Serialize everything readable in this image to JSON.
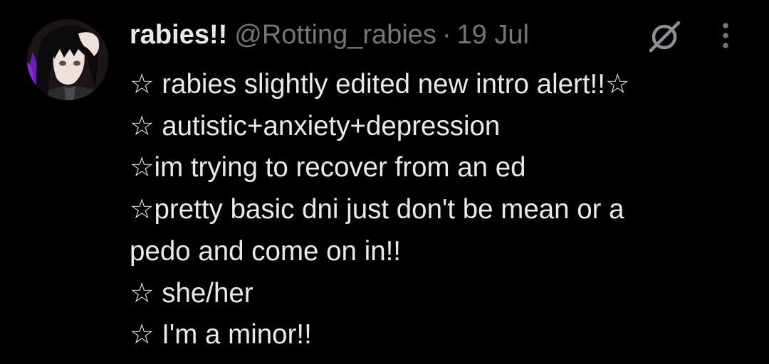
{
  "post": {
    "display_name": "rabies!!",
    "handle": "@Rotting_rabies",
    "separator": "·",
    "date": "19 Jul",
    "icons": {
      "avatar": "profile-avatar-image",
      "muted": "muted-circle-slash-icon",
      "more": "more-vertical-icon"
    },
    "lines": [
      "☆ rabies slightly edited new intro alert!!☆",
      "☆ autistic+anxiety+depression",
      "☆im trying to recover from an ed",
      "☆pretty basic dni just don't be mean or a",
      "pedo and come on in!!",
      "☆ she/her",
      "☆ I'm a minor!!"
    ]
  },
  "colors": {
    "background": "#000000",
    "primary_text": "#e7e9ea",
    "secondary_text": "#71767b",
    "avatar_accent": "#8a2be2"
  }
}
